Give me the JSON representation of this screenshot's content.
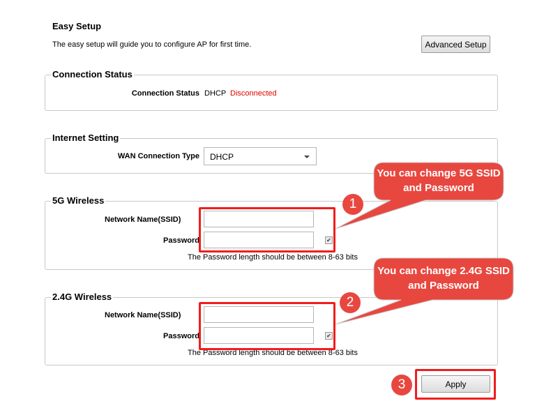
{
  "header": {
    "title": "Easy Setup",
    "description": "The easy setup will guide you to configure AP for first time.",
    "advanced_button": "Advanced Setup"
  },
  "connection_status": {
    "legend": "Connection Status",
    "label": "Connection Status",
    "type": "DHCP",
    "state": "Disconnected",
    "state_color": "#e00000"
  },
  "internet_setting": {
    "legend": "Internet Setting",
    "wan_label": "WAN Connection Type",
    "wan_value": "DHCP"
  },
  "wireless_5g": {
    "legend": "5G Wireless",
    "ssid_label": "Network Name(SSID)",
    "ssid_value": "",
    "password_label": "Password",
    "password_value": "",
    "show_password_checked": true,
    "hint": "The Password length should be between 8-63 bits"
  },
  "wireless_24g": {
    "legend": "2.4G Wireless",
    "ssid_label": "Network Name(SSID)",
    "ssid_value": "",
    "password_label": "Password",
    "password_value": "",
    "show_password_checked": true,
    "hint": "The Password length should be between 8-63 bits"
  },
  "apply_button": "Apply",
  "annotations": {
    "accent": "#e8473f",
    "callout_1": "You can change 5G SSID and Password",
    "callout_2": "You can change 2.4G SSID and Password",
    "step_1": "1",
    "step_2": "2",
    "step_3": "3"
  }
}
